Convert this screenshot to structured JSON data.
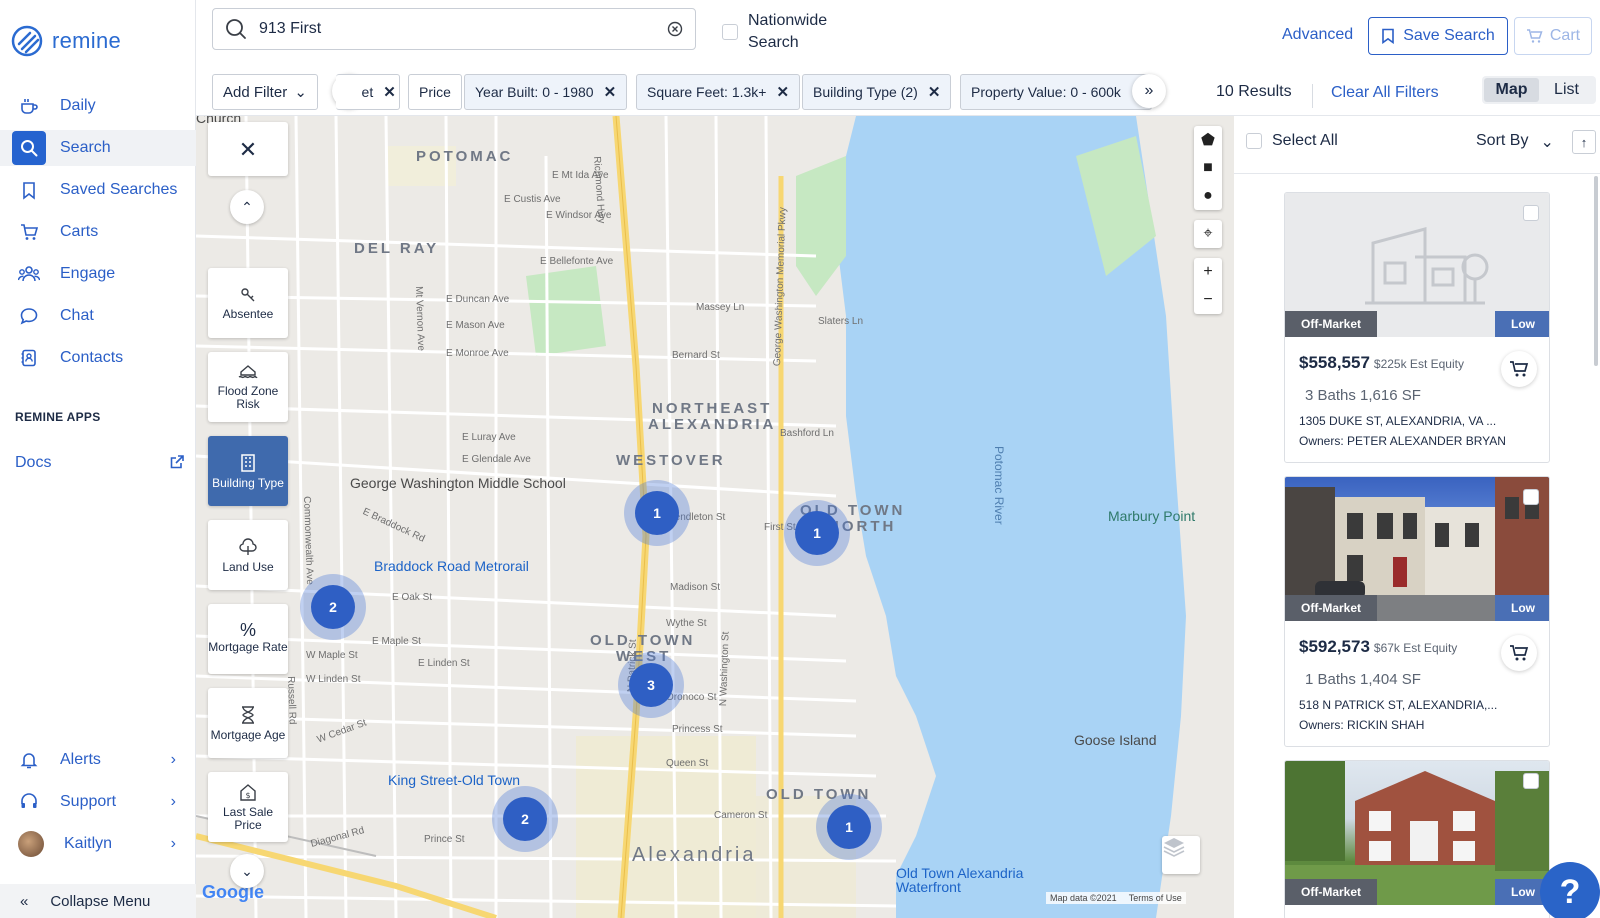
{
  "app": {
    "name": "remine"
  },
  "nav": {
    "items": [
      {
        "label": "Daily",
        "icon": "coffee-icon"
      },
      {
        "label": "Search",
        "icon": "search-icon",
        "active": true
      },
      {
        "label": "Saved Searches",
        "icon": "bookmark-icon"
      },
      {
        "label": "Carts",
        "icon": "cart-icon"
      },
      {
        "label": "Engage",
        "icon": "people-icon"
      },
      {
        "label": "Chat",
        "icon": "chat-icon"
      },
      {
        "label": "Contacts",
        "icon": "contacts-icon"
      }
    ],
    "apps_title": "REMINE APPS",
    "docs_label": "Docs",
    "alerts_label": "Alerts",
    "support_label": "Support",
    "user_label": "Kaitlyn",
    "collapse_label": "Collapse Menu"
  },
  "search": {
    "value": "913 First",
    "nationwide_label": "Nationwide Search"
  },
  "toolbar": {
    "advanced_label": "Advanced",
    "save_search_label": "Save Search",
    "cart_label": "Cart"
  },
  "filters": {
    "add_filter_label": "Add Filter",
    "chips": [
      {
        "label": "    et",
        "removable": true
      },
      {
        "label": "Price",
        "removable": false
      },
      {
        "label": "Year Built: 0 - 1980",
        "removable": true
      },
      {
        "label": "Square Feet: 1.3k+",
        "removable": true
      },
      {
        "label": "Building Type (2)",
        "removable": true
      },
      {
        "label": "Property Value: 0 - 600k",
        "removable": false
      }
    ],
    "results_label": "10 Results",
    "clear_all_label": "Clear All Filters",
    "view_map_label": "Map",
    "view_list_label": "List",
    "active_view": "Map"
  },
  "map_rail": [
    {
      "label": "Absentee",
      "icon": "absentee-icon"
    },
    {
      "label": "Flood Zone Risk",
      "icon": "flood-icon"
    },
    {
      "label": "Building Type",
      "icon": "building-icon",
      "active": true
    },
    {
      "label": "Land Use",
      "icon": "tree-icon"
    },
    {
      "label": "Mortgage Rate",
      "icon": "percent-icon"
    },
    {
      "label": "Mortgage Age",
      "icon": "hourglass-icon"
    },
    {
      "label": "Last Sale Price",
      "icon": "price-tag-icon"
    }
  ],
  "map": {
    "neighborhoods": [
      "POTOMAC",
      "DEL RAY",
      "NORTHEAST",
      "ALEXANDRIA",
      "WESTOVER",
      "OLD TOWN",
      "NORTH",
      "OLD TOWN",
      "WEST",
      "OLD TOWN"
    ],
    "city_label": "Alexandria",
    "pois": [
      "George Washington Middle School",
      "Braddock Road Metrorail",
      "King Street-Old Town",
      "Old Town Alexandria Waterfront",
      "Marbury Point",
      "Goose Island",
      "Potomac River",
      "Church"
    ],
    "streets": [
      "Richmond Hwy",
      "E Braddock Rd",
      "E Oak St",
      "Madison St",
      "Wythe St",
      "Princess St",
      "Queen St",
      "Cameron St",
      "Prince St",
      "N Patrick St",
      "N Washington St",
      "George Washington Memorial Pkwy",
      "Commonwealth Ave",
      "Russell Rd",
      "Mt Vernon Ave",
      "W Maple St",
      "W Linden St",
      "W Cedar St",
      "E Mason Ave",
      "E Monroe Ave",
      "E Luray Ave",
      "E Glendale Ave",
      "E Duncan Ave",
      "E Bellefonte Ave",
      "E Windsor Ave",
      "E Custis Ave",
      "E Mt Ida Ave",
      "Bernard St",
      "Slaters Ln",
      "Massey Ln",
      "First St",
      "Pendleton St",
      "Oronoco St",
      "Diagonal Rd",
      "Bashford Ln",
      "E Maple St",
      "E Linden St"
    ],
    "clusters": [
      "1",
      "1",
      "2",
      "3",
      "2",
      "1"
    ],
    "footer": [
      "Map data ©2021",
      "Terms of Use"
    ],
    "google_label": "Google"
  },
  "list": {
    "select_all_label": "Select All",
    "sort_label": "Sort By",
    "cards": [
      {
        "price": "$558,557",
        "equity": "$225k Est Equity",
        "details": "3 Baths 1,616 SF",
        "address": "1305 DUKE ST, ALEXANDRIA, VA ...",
        "owners": "Owners: PETER ALEXANDER BRYAN",
        "status": "Off-Market",
        "level": "Low",
        "photo": "placeholder"
      },
      {
        "price": "$592,573",
        "equity": "$67k Est Equity",
        "details": "1 Baths 1,404 SF",
        "address": "518 N PATRICK ST, ALEXANDRIA,...",
        "owners": "Owners: RICKIN SHAH",
        "status": "Off-Market",
        "level": "Low",
        "photo": "townhouse"
      },
      {
        "price": "",
        "equity": "",
        "details": "",
        "address": "",
        "owners": "",
        "status": "Off-Market",
        "level": "Low",
        "photo": "brick-house"
      }
    ]
  },
  "colors": {
    "brand": "#2b5fc7",
    "cluster": "#2f5fc4",
    "water": "#a9d3f5",
    "park": "#c6e8c2"
  }
}
